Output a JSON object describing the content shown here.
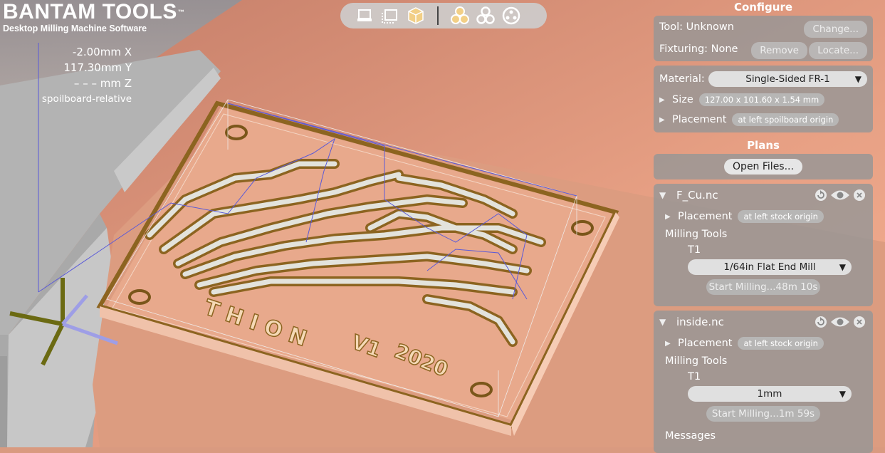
{
  "brand": {
    "name": "BANTAM TOOLS",
    "trademark": "™",
    "tagline": "Desktop Milling Machine Software"
  },
  "position": {
    "x": "-2.00mm X",
    "y": "117.30mm Y",
    "z": "– – – mm Z",
    "mode": "spoilboard-relative"
  },
  "toolbar": {
    "buttons": [
      {
        "icon": "front-view-icon",
        "active": false
      },
      {
        "icon": "top-view-icon",
        "active": false
      },
      {
        "icon": "3d-view-icon",
        "active": true
      },
      {
        "icon": "toolpath-view-icon",
        "active": true
      },
      {
        "icon": "board-outline-icon",
        "active": false
      },
      {
        "icon": "holes-view-icon",
        "active": false
      }
    ]
  },
  "configure": {
    "title": "Configure",
    "tool_label": "Tool: Unknown",
    "change_button": "Change...",
    "fixturing_label": "Fixturing: None",
    "remove_button": "Remove",
    "locate_button": "Locate...",
    "material_label": "Material:",
    "material_value": "Single-Sided FR-1",
    "size_label": "Size",
    "size_value": "127.00 x 101.60 x 1.54 mm",
    "placement_label": "Placement",
    "placement_value": "at left spoilboard origin"
  },
  "plans": {
    "title": "Plans",
    "open_files_button": "Open Files...",
    "files": [
      {
        "name": "F_Cu.nc",
        "placement_label": "Placement",
        "placement_value": "at left stock origin",
        "milling_tools_label": "Milling Tools",
        "tool_id": "T1",
        "tool_value": "1/64in Flat End Mill",
        "start_button": "Start Milling...48m 10s"
      },
      {
        "name": "inside.nc",
        "placement_label": "Placement",
        "placement_value": "at left stock origin",
        "milling_tools_label": "Milling Tools",
        "tool_id": "T1",
        "tool_value": "1mm",
        "start_button": "Start Milling...1m 59s"
      }
    ]
  },
  "messages_label": "Messages",
  "board_text": [
    "T H I O N",
    "V1",
    "2020"
  ],
  "colors": {
    "copper": "#e7a283",
    "accent": "#e3b95a",
    "panel": "#969696",
    "toolpath": "#5a5ad8"
  }
}
